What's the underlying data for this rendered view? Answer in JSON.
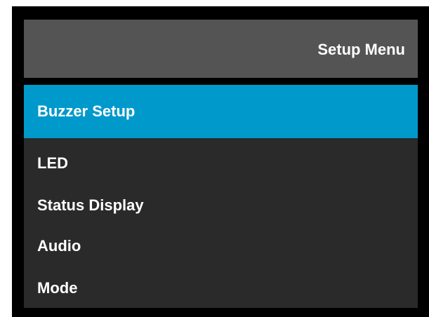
{
  "header": {
    "title": "Setup Menu"
  },
  "menu": {
    "items": [
      {
        "label": "Buzzer Setup",
        "selected": true
      },
      {
        "label": "LED",
        "selected": false
      },
      {
        "label": "Status Display",
        "selected": false
      },
      {
        "label": "Audio",
        "selected": false
      },
      {
        "label": "Mode",
        "selected": false
      }
    ]
  },
  "colors": {
    "background": "#000000",
    "header": "#545454",
    "menu": "#2a2a2a",
    "selected": "#0099cc",
    "text": "#ffffff"
  }
}
